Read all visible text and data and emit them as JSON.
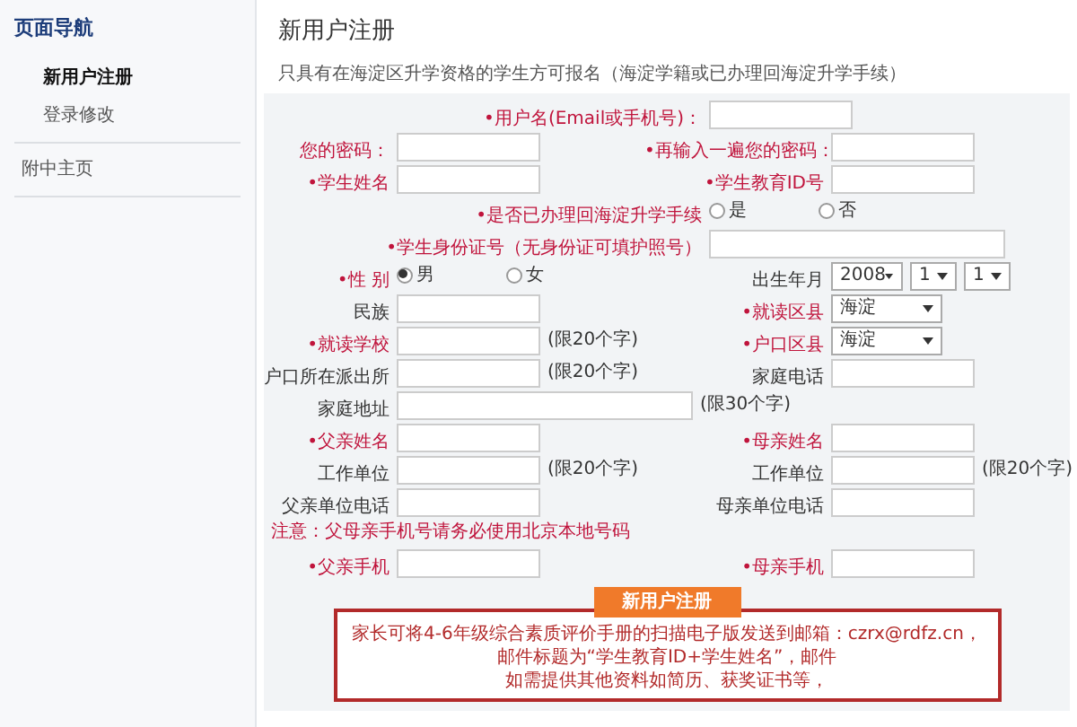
{
  "sidebar": {
    "title": "页面导航",
    "sections": [
      {
        "items": [
          {
            "label": "新用户注册",
            "selected": true
          },
          {
            "label": "登录修改",
            "selected": false
          }
        ]
      },
      {
        "items": [
          {
            "label": "附中主页",
            "selected": false
          }
        ]
      }
    ]
  },
  "page": {
    "title": "新用户注册",
    "intro": "只具有在海淀区升学资格的学生方可报名（海淀学籍或已办理回海淀升学手续）"
  },
  "form": {
    "rows": [
      {
        "kind": "center",
        "field": {
          "label": "•用户名(Email或手机号)：",
          "required": true,
          "control": {
            "kind": "input"
          }
        }
      },
      {
        "kind": "pair",
        "left": {
          "label": "您的密码：",
          "required": true,
          "control": {
            "kind": "input"
          }
        },
        "right": {
          "label": "•再输入一遍您的密码：",
          "required": true,
          "control": {
            "kind": "input"
          }
        }
      },
      {
        "kind": "pair",
        "left": {
          "label": "•学生姓名",
          "required": true,
          "control": {
            "kind": "input"
          }
        },
        "right": {
          "label": "•学生教育ID号",
          "required": true,
          "control": {
            "kind": "input"
          }
        }
      },
      {
        "kind": "center",
        "field": {
          "label": "•是否已办理回海淀升学手续",
          "required": true,
          "control": {
            "kind": "radio",
            "options": [
              {
                "label": "是",
                "selected": false
              },
              {
                "label": "否",
                "selected": false
              }
            ]
          }
        }
      },
      {
        "kind": "center",
        "field": {
          "label": "•学生身份证号（无身份证可填护照号）",
          "required": true,
          "control": {
            "kind": "long_input"
          }
        }
      },
      {
        "kind": "pair",
        "left": {
          "label": "•性 别",
          "required": true,
          "control": {
            "kind": "radio",
            "options": [
              {
                "label": "男",
                "selected": true
              },
              {
                "label": "女",
                "selected": false
              }
            ]
          }
        },
        "right": {
          "label": "出生年月",
          "required": false,
          "control": {
            "kind": "date",
            "values": [
              "2008",
              "1",
              "1"
            ]
          }
        }
      },
      {
        "kind": "pair",
        "left": {
          "label": "民族",
          "required": false,
          "control": {
            "kind": "input"
          }
        },
        "right": {
          "label": "•就读区县",
          "required": true,
          "control": {
            "kind": "select",
            "value": "海淀"
          }
        }
      },
      {
        "kind": "pair",
        "left": {
          "label": "•就读学校",
          "required": true,
          "control": {
            "kind": "input"
          },
          "hint": "(限20个字)"
        },
        "right": {
          "label": "•户口区县",
          "required": true,
          "control": {
            "kind": "select",
            "value": "海淀"
          }
        }
      },
      {
        "kind": "pair",
        "left": {
          "label": "户口所在派出所",
          "required": false,
          "control": {
            "kind": "input"
          },
          "hint": "(限20个字)"
        },
        "right": {
          "label": "家庭电话",
          "required": false,
          "control": {
            "kind": "input"
          }
        }
      },
      {
        "kind": "single",
        "field": {
          "label": "家庭地址",
          "required": false,
          "control": {
            "kind": "long_input"
          },
          "hint": "(限30个字)"
        }
      },
      {
        "kind": "pair",
        "left": {
          "label": "•父亲姓名",
          "required": true,
          "control": {
            "kind": "input"
          }
        },
        "right": {
          "label": "•母亲姓名",
          "required": true,
          "control": {
            "kind": "input"
          }
        }
      },
      {
        "kind": "pair",
        "left": {
          "label": "工作单位",
          "required": false,
          "control": {
            "kind": "input"
          },
          "hint": "(限20个字)"
        },
        "right": {
          "label": "工作单位",
          "required": false,
          "control": {
            "kind": "input"
          },
          "hint": "(限20个字)"
        }
      },
      {
        "kind": "pair",
        "left": {
          "label": "父亲单位电话",
          "required": false,
          "control": {
            "kind": "input"
          }
        },
        "right": {
          "label": "母亲单位电话",
          "required": false,
          "control": {
            "kind": "input"
          }
        }
      },
      {
        "kind": "note",
        "text": "注意：父母亲手机号请务必使用北京本地号码"
      },
      {
        "kind": "pair",
        "left": {
          "label": "•父亲手机",
          "required": true,
          "control": {
            "kind": "input"
          }
        },
        "right": {
          "label": "•母亲手机",
          "required": true,
          "control": {
            "kind": "input"
          }
        }
      }
    ],
    "submit": "新用户注册",
    "notice": [
      "家长可将4-6年级综合素质评价手册的扫描电子版发送到邮箱：czrx@rdfz.cn，",
      "邮件标题为“学生教育ID+学生姓名”，邮件",
      "如需提供其他资料如简历、获奖证书等，"
    ]
  }
}
